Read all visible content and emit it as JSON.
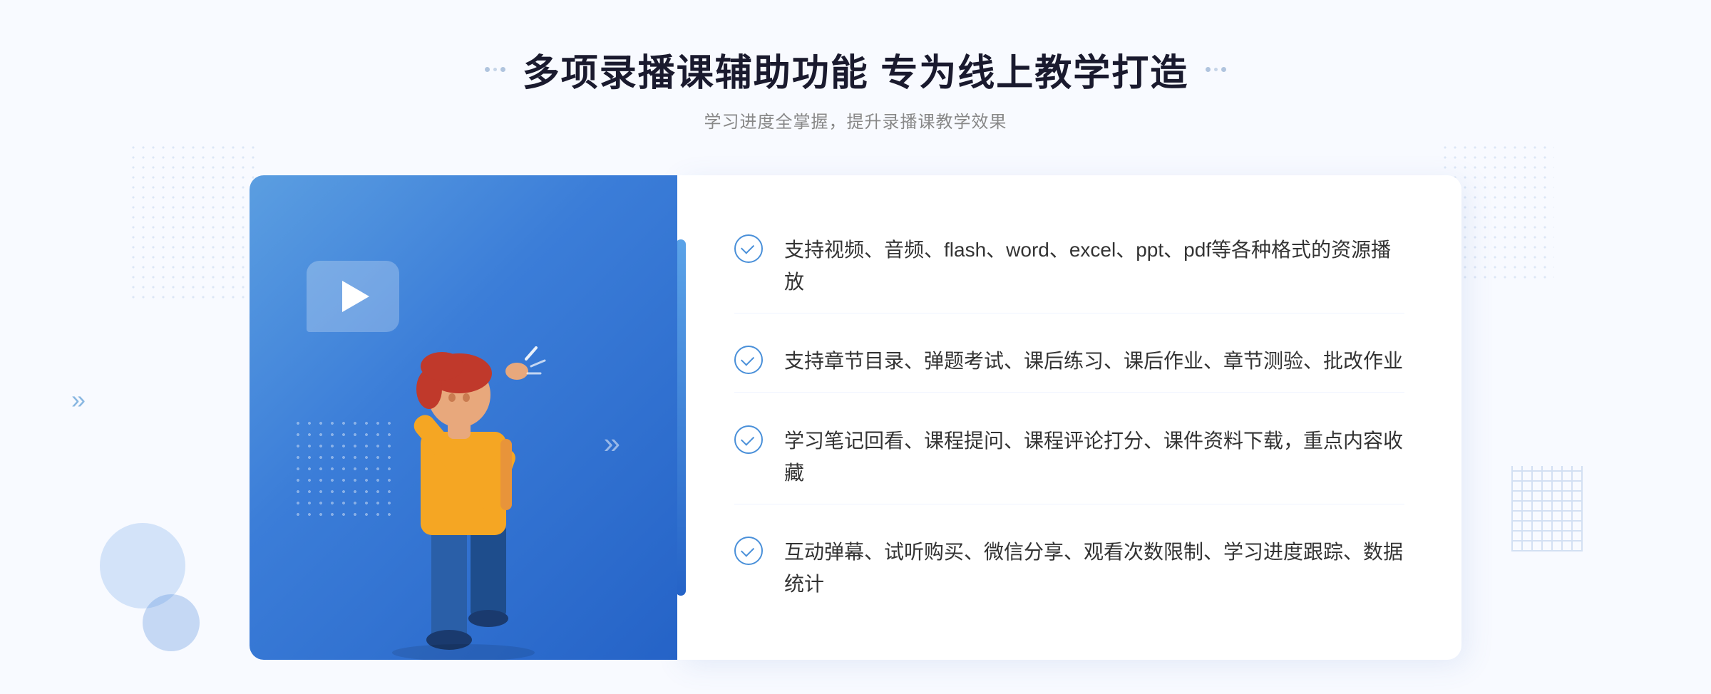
{
  "header": {
    "title": "多项录播课辅助功能 专为线上教学打造",
    "subtitle": "学习进度全掌握，提升录播课教学效果",
    "decorator_left": "⁞⁞",
    "decorator_right": "⁞⁞"
  },
  "features": [
    {
      "id": 1,
      "text": "支持视频、音频、flash、word、excel、ppt、pdf等各种格式的资源播放"
    },
    {
      "id": 2,
      "text": "支持章节目录、弹题考试、课后练习、课后作业、章节测验、批改作业"
    },
    {
      "id": 3,
      "text": "学习笔记回看、课程提问、课程评论打分、课件资料下载，重点内容收藏"
    },
    {
      "id": 4,
      "text": "互动弹幕、试听购买、微信分享、观看次数限制、学习进度跟踪、数据统计"
    }
  ],
  "colors": {
    "primary_blue": "#3b7dd8",
    "light_blue": "#5ba3e8",
    "text_dark": "#1a1a2e",
    "text_gray": "#888888",
    "check_blue": "#4a90d9"
  }
}
